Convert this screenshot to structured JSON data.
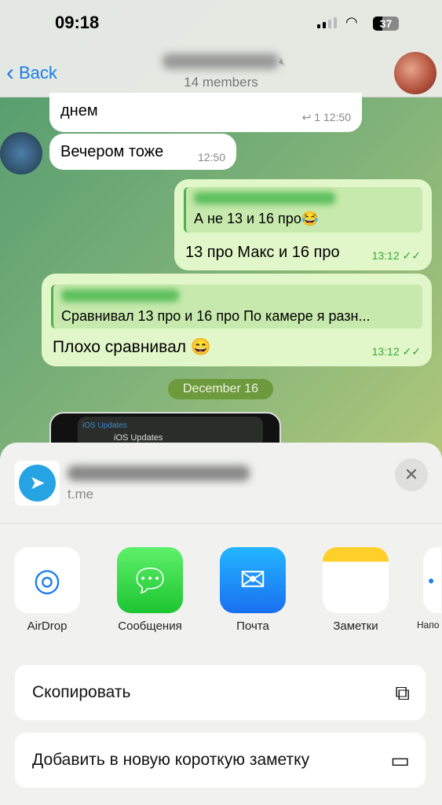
{
  "status_bar": {
    "time": "09:18",
    "battery": "37"
  },
  "header": {
    "back_label": "Back",
    "members": "14 members"
  },
  "messages": [
    {
      "text": "днем",
      "replies": "1",
      "time": "12:50"
    },
    {
      "text": "Вечером тоже",
      "time": "12:50"
    },
    {
      "quote_text": "А не 13 и 16 про😂",
      "text": "13 про Макс и 16 про",
      "time": "13:12"
    },
    {
      "quote_text": "Сравнивал 13 про и 16 про По камере я разн...",
      "text": "Плохо сравнивал 😄",
      "time": "13:12"
    }
  ],
  "date_separator": "December 16",
  "media_preview": {
    "header": "iOS Updates",
    "item": "iOS Updates"
  },
  "share_sheet": {
    "url": "t.me",
    "apps": [
      {
        "label": "AirDrop"
      },
      {
        "label": "Сообщения"
      },
      {
        "label": "Почта"
      },
      {
        "label": "Заметки"
      },
      {
        "label": "Напо"
      }
    ],
    "actions": [
      {
        "label": "Скопировать"
      },
      {
        "label": "Добавить в новую короткую заметку"
      }
    ]
  }
}
